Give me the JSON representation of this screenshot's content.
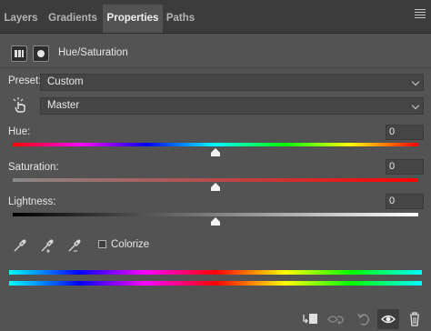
{
  "tabs": [
    {
      "label": "Layers"
    },
    {
      "label": "Gradients"
    },
    {
      "label": "Properties"
    },
    {
      "label": "Paths"
    }
  ],
  "adjustment": {
    "title": "Hue/Saturation",
    "icons": [
      "adjustment-grid-icon",
      "layer-mask-icon"
    ]
  },
  "preset": {
    "label": "Preset:",
    "value": "Custom"
  },
  "channel": {
    "value": "Master"
  },
  "sliders": {
    "hue": {
      "label": "Hue:",
      "value": "0",
      "level": 0
    },
    "saturation": {
      "label": "Saturation:",
      "value": "0",
      "level": 0
    },
    "lightness": {
      "label": "Lightness:",
      "value": "0",
      "level": 0
    }
  },
  "colorize": {
    "label": "Colorize",
    "checked": false
  },
  "footer_icons": [
    "clip-to-layer-icon",
    "view-previous-state-icon",
    "reset-icon",
    "visibility-eye-icon",
    "delete-trash-icon"
  ]
}
